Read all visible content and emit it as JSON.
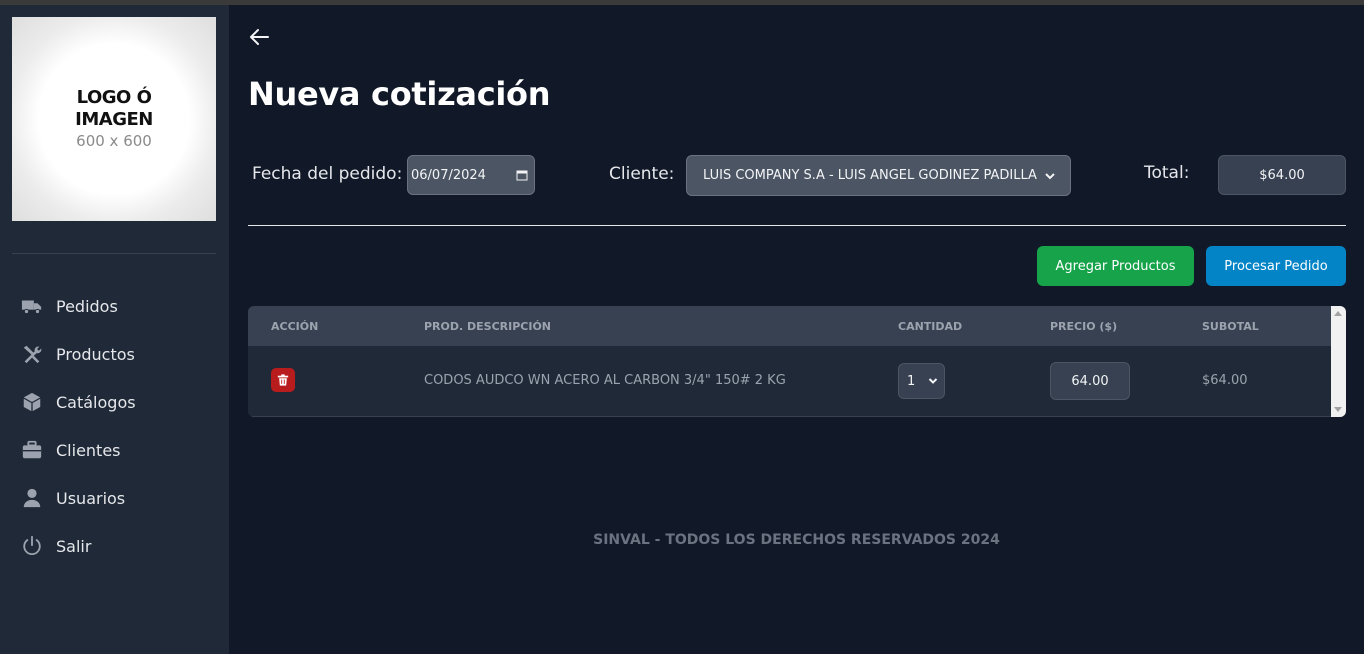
{
  "sidebar": {
    "logo": {
      "line1": "LOGO Ó",
      "line2": "IMAGEN",
      "line3": "600 x 600"
    },
    "items": [
      {
        "label": "Pedidos",
        "icon": "truck-icon"
      },
      {
        "label": "Productos",
        "icon": "tools-icon"
      },
      {
        "label": "Catálogos",
        "icon": "box-icon"
      },
      {
        "label": "Clientes",
        "icon": "briefcase-icon"
      },
      {
        "label": "Usuarios",
        "icon": "user-icon"
      },
      {
        "label": "Salir",
        "icon": "power-icon"
      }
    ]
  },
  "main": {
    "title": "Nueva cotización",
    "form": {
      "date_label": "Fecha del pedido:",
      "date_value": "06/07/2024",
      "client_label": "Cliente:",
      "client_value": "LUIS COMPANY S.A - LUIS ANGEL GODINEZ PADILLA",
      "total_label": "Total:",
      "total_value": "$64.00"
    },
    "buttons": {
      "add_products": "Agregar Productos",
      "process_order": "Procesar Pedido"
    },
    "table": {
      "headers": [
        "ACCIÓN",
        "PROD. DESCRIPCIÓN",
        "CANTIDAD",
        "PRECIO ($)",
        "SUBOTAL"
      ],
      "rows": [
        {
          "description": "CODOS AUDCO WN ACERO AL CARBON 3/4\" 150# 2 KG",
          "quantity": "1",
          "price": "64.00",
          "subtotal": "$64.00"
        }
      ]
    },
    "footer": "SINVAL - TODOS LOS DERECHOS RESERVADOS 2024"
  },
  "colors": {
    "background": "#111827",
    "sidebar": "#1f2937",
    "green_button": "#16a34a",
    "blue_button": "#0284c7",
    "delete_button": "#b91c1c"
  }
}
